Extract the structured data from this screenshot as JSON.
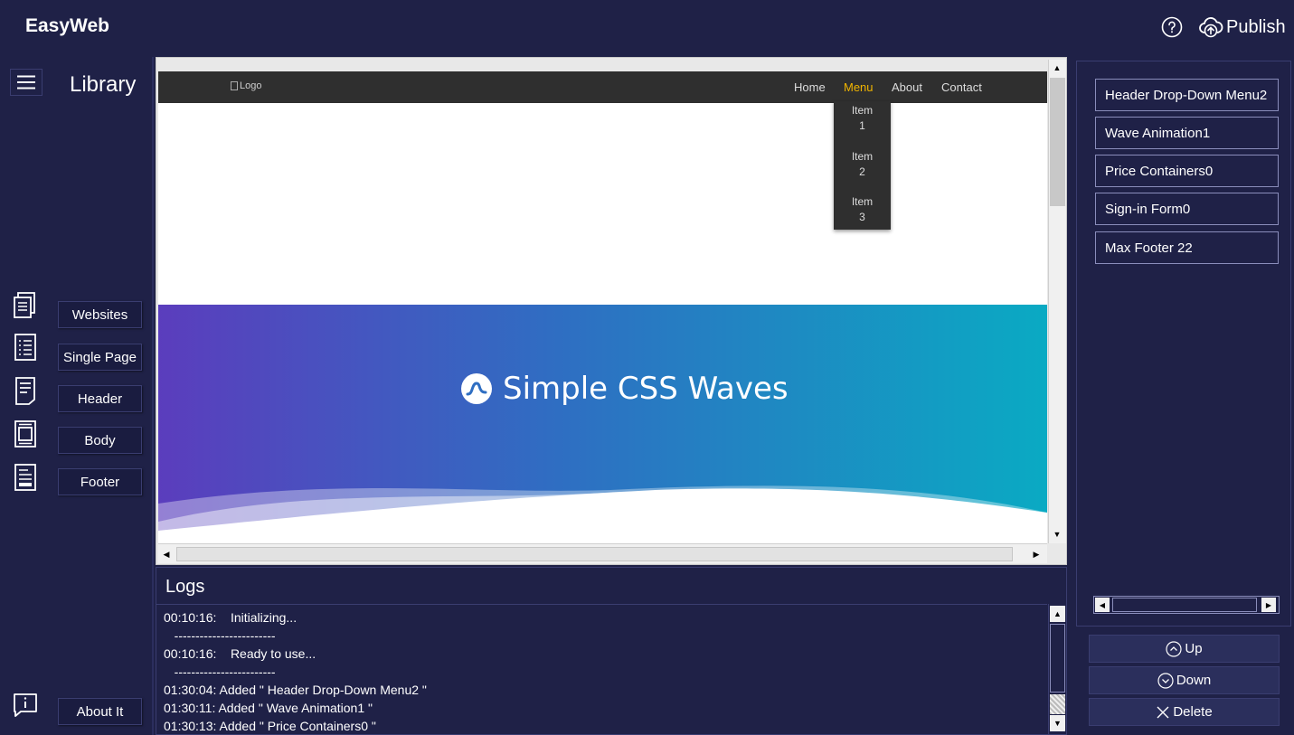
{
  "app": {
    "title": "EasyWeb"
  },
  "topbar": {
    "publish_label": "Publish",
    "help_icon": "help-icon",
    "publish_icon": "cloud-upload-icon"
  },
  "library": {
    "title": "Library",
    "items": [
      {
        "label": "Websites",
        "icon": "websites-icon"
      },
      {
        "label": "Single Page",
        "icon": "single-page-icon"
      },
      {
        "label": "Header",
        "icon": "header-icon"
      },
      {
        "label": "Body",
        "icon": "body-icon"
      },
      {
        "label": "Footer",
        "icon": "footer-icon"
      }
    ],
    "about_label": "About It"
  },
  "preview": {
    "logo_alt": "Logo",
    "nav": [
      "Home",
      "Menu",
      "About",
      "Contact"
    ],
    "active_nav": "Menu",
    "dropdown": [
      {
        "line1": "Item",
        "line2": "1"
      },
      {
        "line1": "Item",
        "line2": "2"
      },
      {
        "line1": "Item",
        "line2": "3"
      }
    ],
    "hero_title": "Simple CSS Waves",
    "accent_color": "#f0b400"
  },
  "logs": {
    "title": "Logs",
    "lines": [
      "00:10:16:    Initializing...",
      "   ------------------------",
      "00:10:16:    Ready to use...",
      "   ------------------------",
      "01:30:04: Added \" Header Drop-Down Menu2 \"",
      "01:30:11: Added \" Wave Animation1 \"",
      "01:30:13: Added \" Price Containers0 \""
    ]
  },
  "components": [
    "Header Drop-Down Menu2",
    "Wave Animation1",
    "Price Containers0",
    "Sign-in Form0",
    "Max Footer 22"
  ],
  "actions": {
    "up": "Up",
    "down": "Down",
    "delete": "Delete"
  }
}
